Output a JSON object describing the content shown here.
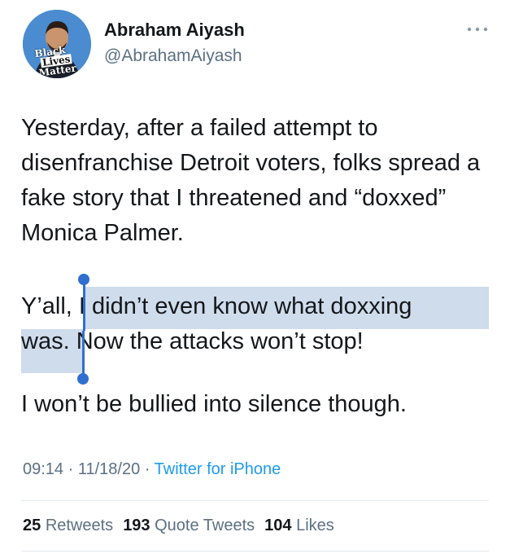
{
  "author": {
    "display_name": "Abraham Aiyash",
    "handle": "@AbrahamAiyash",
    "avatar_badge": [
      "Black",
      "Lives",
      "Matter"
    ]
  },
  "menu_icon": "more-icon",
  "tweet": {
    "p1": "Yesterday, after a failed attempt to disenfranchise Detroit voters, folks spread a fake story that I threatened and “doxxed” Monica Palmer.",
    "p2_prefix": "Y’all, ",
    "p2_selected_a": "I didn’t even know what doxxing",
    "p2_selected_b": "was.",
    "p2_suffix": " Now the attacks won’t stop!",
    "p3": "I won’t be bullied into silence though."
  },
  "meta": {
    "time": "09:14",
    "sep1": " · ",
    "date": "11/18/20",
    "sep2": " · ",
    "source": "Twitter for iPhone"
  },
  "stats": {
    "retweets_count": "25",
    "retweets_label": "Retweets",
    "quotes_count": "193",
    "quotes_label": "Quote Tweets",
    "likes_count": "104",
    "likes_label": "Likes"
  },
  "colors": {
    "selection": "#cfdcec",
    "selection_handle": "#2f6fd0",
    "link": "#1d9bf0",
    "secondary_text": "#5b7083"
  }
}
